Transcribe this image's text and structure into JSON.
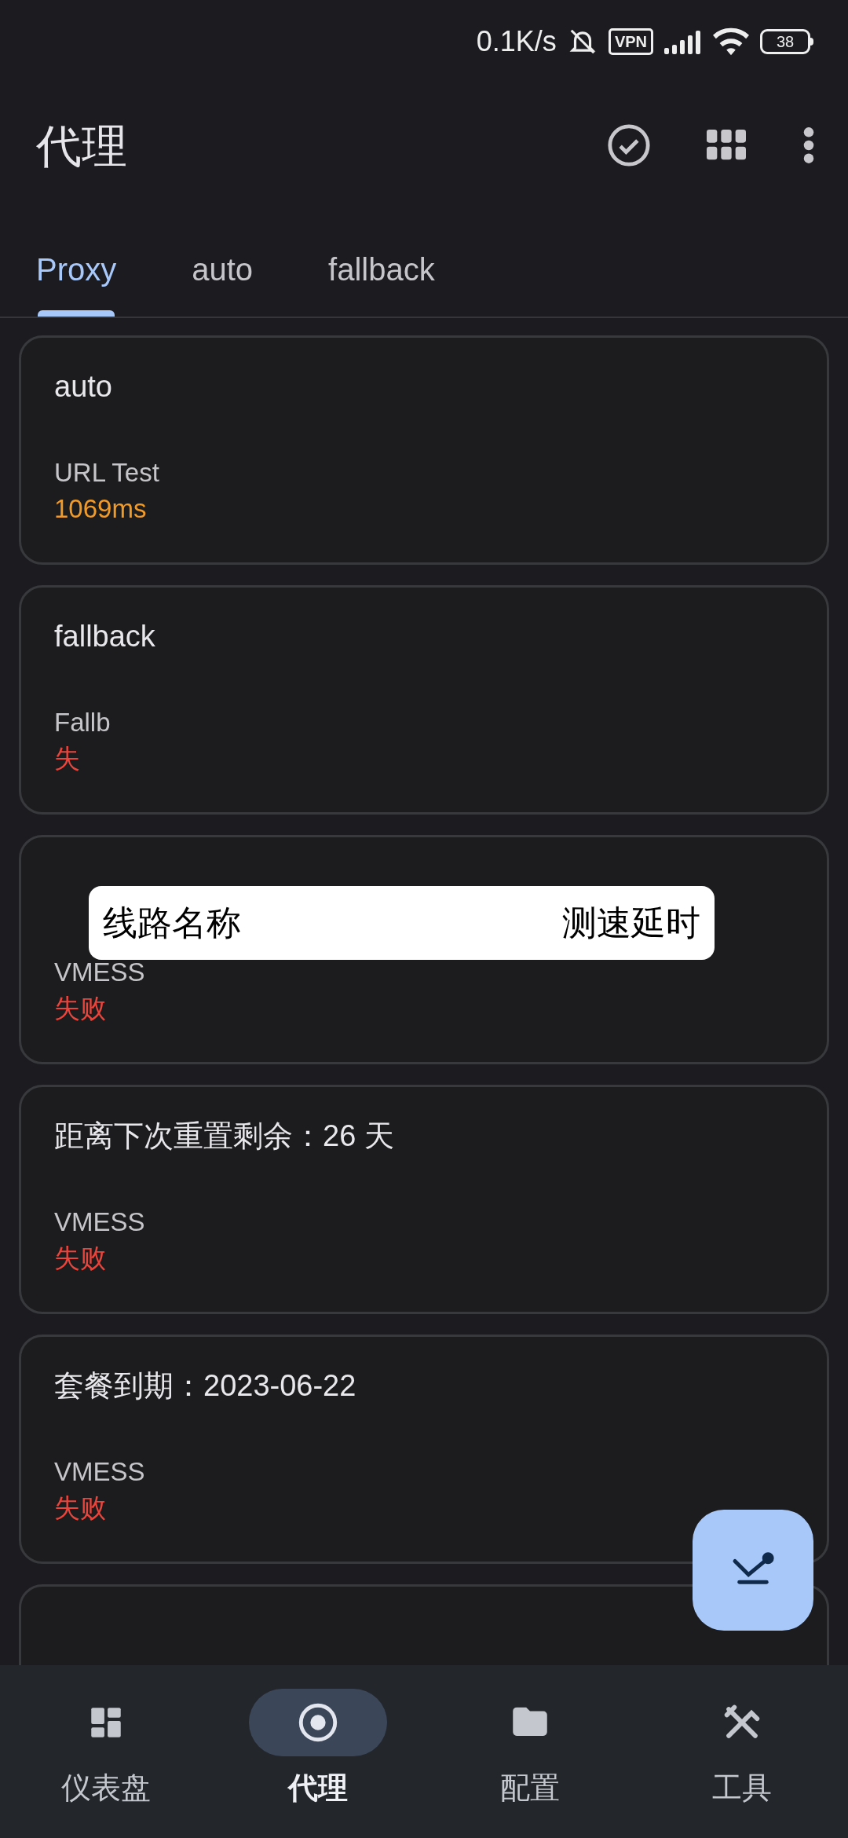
{
  "status_bar": {
    "speed": "0.1K/s",
    "vpn": "VPN",
    "battery": "38"
  },
  "title": "代理",
  "tabs": [
    {
      "label": "Proxy",
      "selected": true
    },
    {
      "label": "auto",
      "selected": false
    },
    {
      "label": "fallback",
      "selected": false
    }
  ],
  "groups": [
    {
      "name": "auto",
      "type": "URL Test",
      "delay": "1069ms",
      "kind": "ok"
    },
    {
      "name": "fallback",
      "type": "Fallb",
      "delay": "失",
      "kind": "fail"
    },
    {
      "type": "VMESS",
      "delay": "失败",
      "kind": "fail"
    },
    {
      "name": "距离下次重置剩余：26 天",
      "type": "VMESS",
      "delay": "失败",
      "kind": "fail"
    },
    {
      "name": "套餐到期：2023-06-22",
      "type": "VMESS",
      "delay": "失败",
      "kind": "fail"
    },
    {
      "kind": "blank"
    }
  ],
  "overlay_label": {
    "left": "线路名称",
    "right": "测速延时"
  },
  "nav": [
    {
      "label": "仪表盘",
      "selected": false
    },
    {
      "label": "代理",
      "selected": true
    },
    {
      "label": "配置",
      "selected": false
    },
    {
      "label": "工具",
      "selected": false
    }
  ]
}
